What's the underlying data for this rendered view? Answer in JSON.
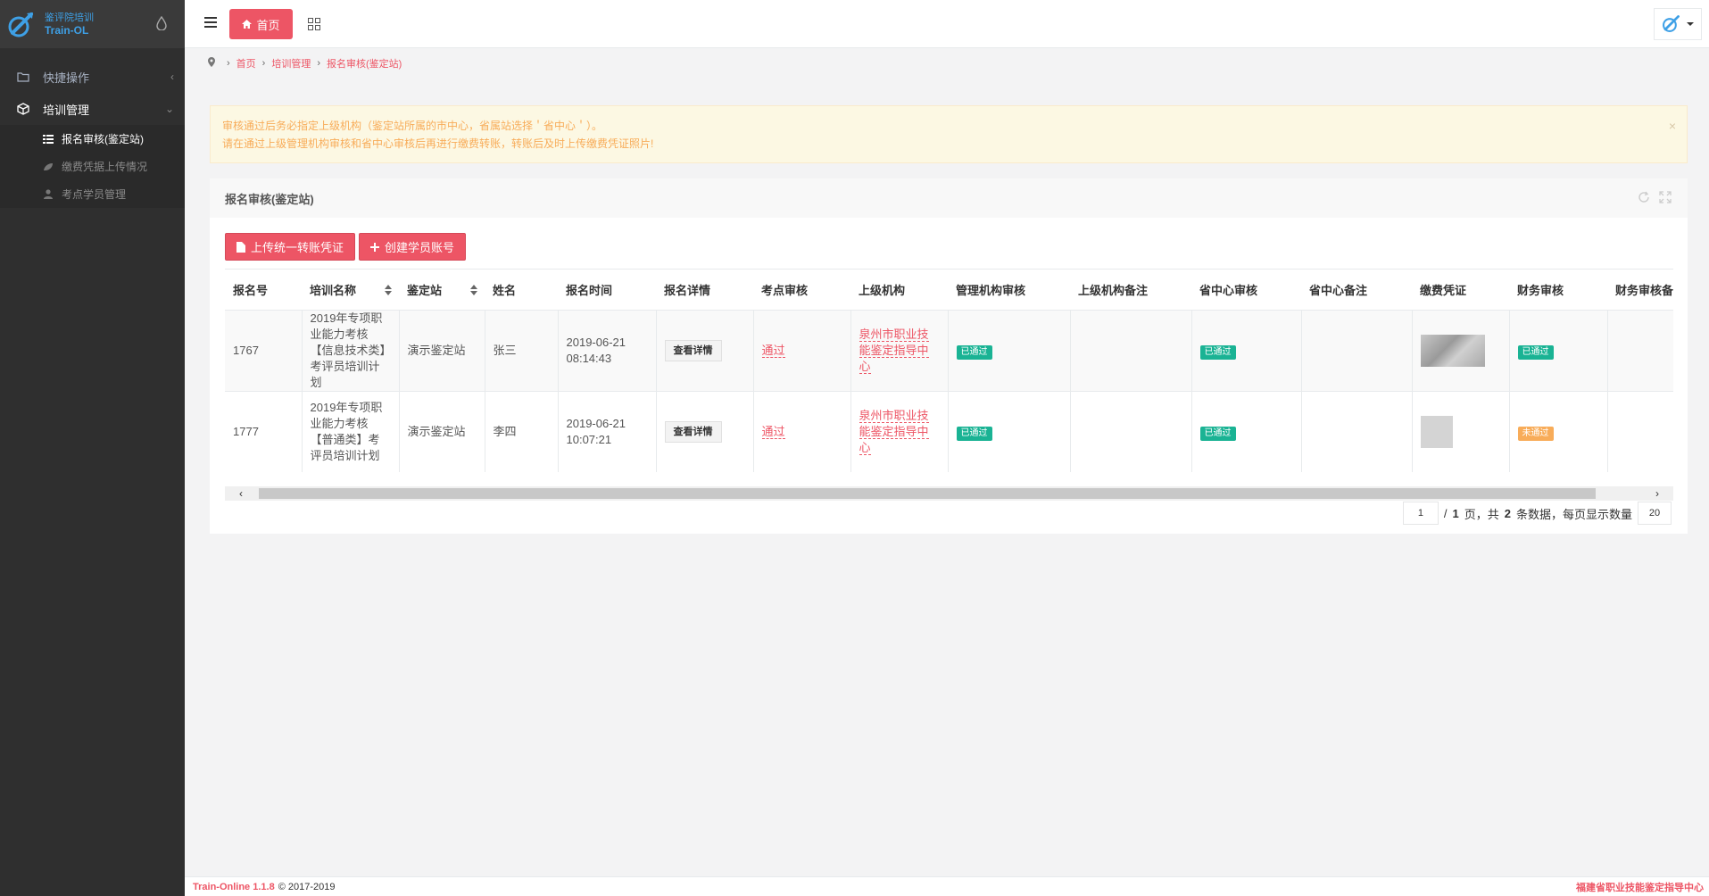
{
  "app": {
    "logo_line1": "鉴评院培训",
    "logo_line2": "Train-OL"
  },
  "sidebar": {
    "items": [
      {
        "label": "快捷操作",
        "icon": "folder-icon"
      },
      {
        "label": "培训管理",
        "icon": "cube-icon"
      }
    ],
    "sub_items": [
      {
        "label": "报名审核(鉴定站)",
        "icon": "list-icon"
      },
      {
        "label": "缴费凭据上传情况",
        "icon": "leaf-icon"
      },
      {
        "label": "考点学员管理",
        "icon": "user-icon"
      }
    ]
  },
  "topbar": {
    "home_tab": "首页"
  },
  "breadcrumb": [
    "首页",
    "培训管理",
    "报名审核(鉴定站)"
  ],
  "alert": {
    "line1": "审核通过后务必指定上级机构（鉴定站所属的市中心，省属站选择＇省中心＇）。",
    "line2": "请在通过上级管理机构审核和省中心审核后再进行缴费转账，转账后及时上传缴费凭证照片!"
  },
  "panel": {
    "title": "报名审核(鉴定站)",
    "btn_upload": "上传统一转账凭证",
    "btn_create": "创建学员账号"
  },
  "table": {
    "headers": [
      "报名号",
      "培训名称",
      "鉴定站",
      "姓名",
      "报名时间",
      "报名详情",
      "考点审核",
      "上级机构",
      "管理机构审核",
      "上级机构备注",
      "省中心审核",
      "省中心备注",
      "缴费凭证",
      "财务审核",
      "财务审核备注"
    ],
    "rows": [
      {
        "id": "1767",
        "training": "2019年专项职业能力考核【信息技术类】考评员培训计划",
        "station": "演示鉴定站",
        "name": "张三",
        "time": "2019-06-21 08:14:43",
        "detail": "查看详情",
        "site_review": "通过",
        "parent_org": "泉州市职业技能鉴定指导中心",
        "mgmt_review": "已通过",
        "parent_note": "",
        "prov_review": "已通过",
        "prov_note": "",
        "finance_review": "已通过",
        "finance_note": ""
      },
      {
        "id": "1777",
        "training": "2019年专项职业能力考核【普通类】考评员培训计划",
        "station": "演示鉴定站",
        "name": "李四",
        "time": "2019-06-21 10:07:21",
        "detail": "查看详情",
        "site_review": "通过",
        "parent_org": "泉州市职业技能鉴定指导中心",
        "mgmt_review": "已通过",
        "parent_note": "",
        "prov_review": "已通过",
        "prov_note": "",
        "finance_review": "未通过",
        "finance_note": ""
      }
    ]
  },
  "pager": {
    "page": "1",
    "text_a": "/",
    "total_pages": "1",
    "text_b": "页，共",
    "total_rows": "2",
    "text_c": "条数据，每页显示数量",
    "page_size": "20"
  },
  "footer": {
    "brand": "Train-Online 1.1.8",
    "copyright": "© 2017-2019",
    "right": "福建省职业技能鉴定指导中心"
  },
  "colors": {
    "accent": "#ed5565",
    "success": "#1ab394",
    "warning": "#f8ac59",
    "sidebar_bg": "#2f2f2f"
  }
}
